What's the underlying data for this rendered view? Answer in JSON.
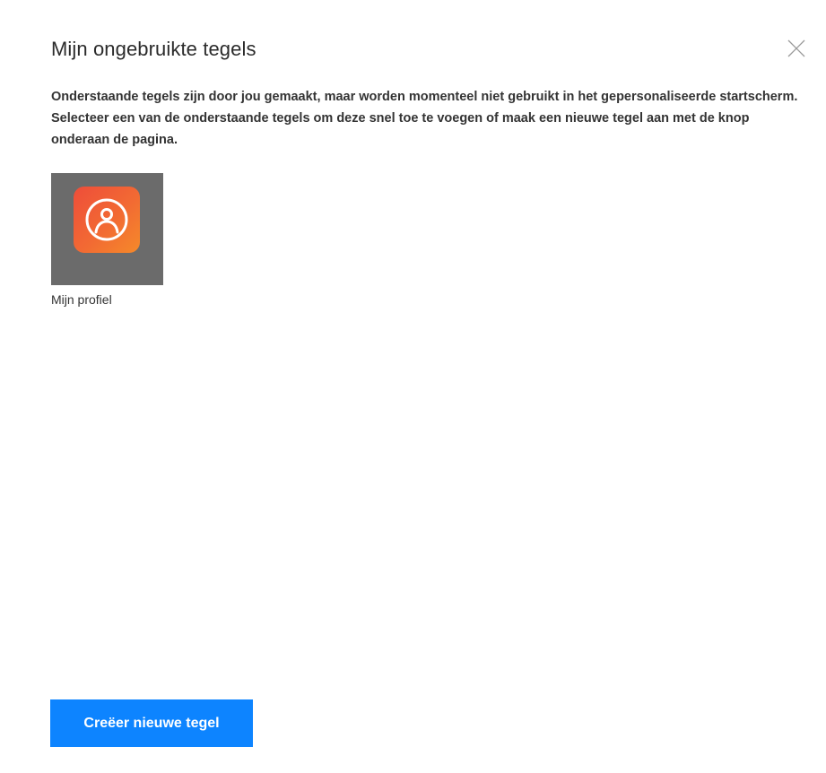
{
  "dialog": {
    "title": "Mijn ongebruikte tegels",
    "close_icon": "close-icon",
    "description": "Onderstaande tegels zijn door jou gemaakt, maar worden momenteel niet gebruikt in het gepersonaliseerde startscherm. Selecteer een van de onderstaande tegels om deze snel toe te voegen of maak een nieuwe tegel aan met de knop onderaan de pagina."
  },
  "tiles": [
    {
      "label": "Mijn profiel",
      "icon": "user-profile-icon",
      "tile_background": "#6b6b6b",
      "icon_gradient": [
        "#ee4d3a",
        "#f58a2a"
      ]
    }
  ],
  "actions": {
    "create_label": "Creëer nieuwe tegel",
    "create_color": "#0d84ff"
  }
}
